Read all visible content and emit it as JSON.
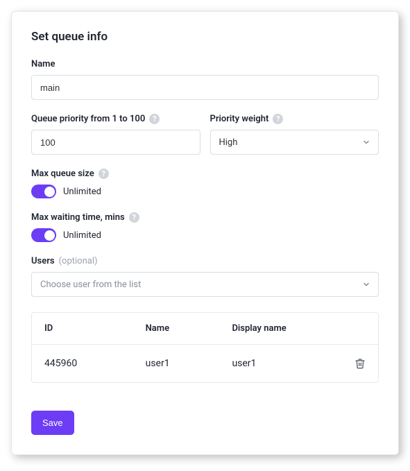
{
  "title": "Set queue info",
  "name": {
    "label": "Name",
    "value": "main"
  },
  "priority": {
    "label": "Queue priority from 1 to 100",
    "value": "100"
  },
  "weight": {
    "label": "Priority weight",
    "selected": "High"
  },
  "maxSize": {
    "label": "Max queue size",
    "toggleLabel": "Unlimited"
  },
  "maxWait": {
    "label": "Max waiting time, mins",
    "toggleLabel": "Unlimited"
  },
  "users": {
    "label": "Users",
    "hint": "(optional)",
    "placeholder": "Choose user from the list"
  },
  "table": {
    "headers": {
      "id": "ID",
      "name": "Name",
      "display": "Display name"
    },
    "rows": [
      {
        "id": "445960",
        "name": "user1",
        "display": "user1"
      }
    ]
  },
  "actions": {
    "save": "Save"
  }
}
